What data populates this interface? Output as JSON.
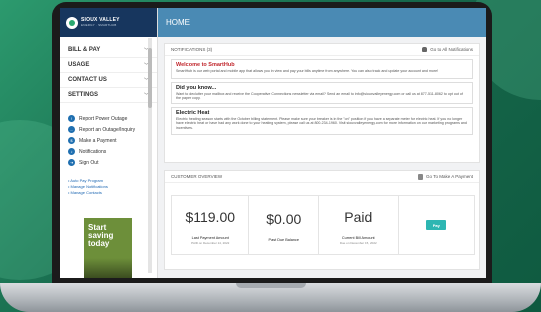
{
  "colors": {
    "header": "#4a8ab4",
    "logo_bg": "#17365e",
    "accent_red": "#c0262c",
    "pay_button": "#2db6b2",
    "link": "#2069b3"
  },
  "logo": {
    "name": "SIOUX VALLEY",
    "sub": "ENERGY · SMARTHUB"
  },
  "topbar": {
    "title": "HOME"
  },
  "nav": [
    {
      "label": "BILL & PAY"
    },
    {
      "label": "USAGE"
    },
    {
      "label": "CONTACT US"
    },
    {
      "label": "SETTINGS"
    }
  ],
  "quick_links": [
    {
      "label": "Report Power Outage",
      "icon": "alert-icon"
    },
    {
      "label": "Report an Outage/Inquiry",
      "icon": "chat-icon"
    },
    {
      "label": "Make a Payment",
      "icon": "dollar-icon"
    },
    {
      "label": "Notifications",
      "icon": "bell-icon"
    },
    {
      "label": "Sign Out",
      "icon": "logout-icon"
    }
  ],
  "links": [
    "Auto Pay Program",
    "Manage Notifications",
    "Manage Contacts"
  ],
  "promo": {
    "text": "Start saving today"
  },
  "notifications": {
    "header": "NOTIFICATIONS (3)",
    "go_all": "Go to All Notifications",
    "items": [
      {
        "title": "Welcome to SmartHub",
        "body": "SmartHub is our web portal and mobile app that allows you in view and pay your bills anytime from anywhere. You can also track and update your account and more!"
      },
      {
        "title": "Did you know...",
        "body": "Want to declutter your mailbox and receive the Cooperative Connections newsletter via email? Send an email to info@siouxvalleyenergy.com or call us at 877-511-8062 to opt out of the paper copy."
      },
      {
        "title": "Electric Heat",
        "body": "Electric heating season starts with the October billing statement. Please make sure your breaker is in the \"on\" position if you have a separate meter for electric heat. If you no longer have electric heat or have had any work done to your heating system, please call us at 800-234-1960. Visit siouxvalleyenergy.com for more information on our marketing programs and incentives."
      }
    ]
  },
  "overview": {
    "header": "CUSTOMER OVERVIEW",
    "go_pay": "Go To Make A Payment",
    "last_payment": {
      "value": "$119.00",
      "label": "Last Payment Amount",
      "sub": "PAID on December 14, 2022"
    },
    "past_due": {
      "value": "$0.00",
      "label": "Past Due Balance"
    },
    "current": {
      "value": "Paid",
      "label": "Current Bill Amount",
      "sub": "Due on December 15, 2022"
    },
    "pay_button": "Pay"
  }
}
